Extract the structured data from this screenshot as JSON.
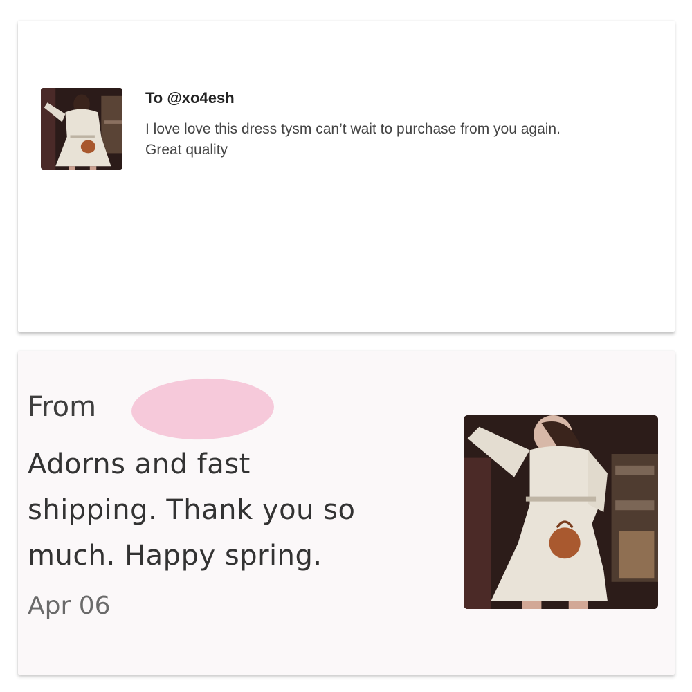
{
  "top_review": {
    "recipient": "To @xo4esh",
    "text_line1": "I love love this dress tysm can’t wait to purchase from you again.",
    "text_line2": "Great quality",
    "photo_icon": "dress-photo"
  },
  "bottom_review": {
    "from_label": "From",
    "sender_redacted": "",
    "text_line1": "Adorns and fast",
    "text_line2": "shipping. Thank you so",
    "text_line3": "much. Happy spring.",
    "date": "Apr 06",
    "photo_icon": "dress-photo"
  },
  "colors": {
    "redaction": "#f6c9da",
    "card_bg_bottom": "#fbf8f9",
    "card_bg_top": "#ffffff"
  }
}
